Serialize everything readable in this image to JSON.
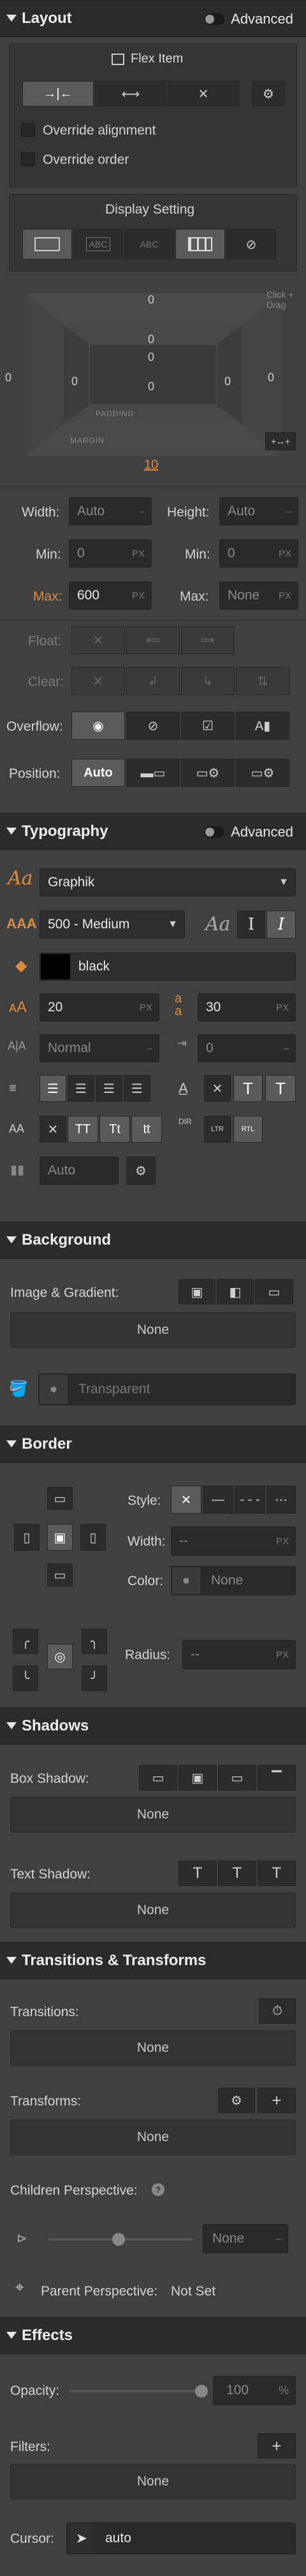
{
  "layout": {
    "title": "Layout",
    "advanced": "Advanced",
    "flex_item": "Flex Item",
    "override_alignment": "Override alignment",
    "override_order": "Override order",
    "display_setting": "Display Setting",
    "display_options": [
      "ABC",
      "ABC"
    ],
    "box": {
      "margin_top": "0",
      "margin_left": "0",
      "margin_right": "0",
      "padding_top": "0",
      "padding_left": "0",
      "padding_right": "0",
      "padding_bottom": "0",
      "padding_label": "PADDING",
      "margin_label": "MARGIN",
      "margin_bottom": "10",
      "hint": "Click + Drag"
    },
    "width_label": "Width:",
    "width_value": "Auto",
    "height_label": "Height:",
    "height_value": "Auto",
    "min_label": "Min:",
    "min_w": "0",
    "min_h": "0",
    "max_label": "Max:",
    "max_w": "600",
    "max_h": "None",
    "unit_px": "PX",
    "float_label": "Float:",
    "clear_label": "Clear:",
    "overflow_label": "Overflow:",
    "position_label": "Position:",
    "position_value": "Auto"
  },
  "typography": {
    "title": "Typography",
    "advanced": "Advanced",
    "font": "Graphik",
    "weight": "500 - Medium",
    "color_name": "black",
    "font_size": "20",
    "line_height": "30",
    "letter_spacing": "Normal",
    "text_indent": "0",
    "columns": "Auto",
    "case_tt1": "TT",
    "case_tt2": "Tt",
    "case_tt3": "tt",
    "dir_ltr": "LTR",
    "dir_rtl": "RTL",
    "dir_label": "DIR",
    "italic": "I",
    "aa_sample": "Aa",
    "swatch_color": "#000000"
  },
  "background": {
    "title": "Background",
    "image_gradient": "Image & Gradient:",
    "none": "None",
    "color": "Transparent"
  },
  "border": {
    "title": "Border",
    "style_label": "Style:",
    "width_label": "Width:",
    "width_value": "--",
    "color_label": "Color:",
    "color_value": "None",
    "radius_label": "Radius:",
    "radius_value": "--"
  },
  "shadows": {
    "title": "Shadows",
    "box_shadow": "Box Shadow:",
    "box_none": "None",
    "text_shadow": "Text Shadow:",
    "text_none": "None"
  },
  "transitions": {
    "title": "Transitions & Transforms",
    "transitions_label": "Transitions:",
    "transitions_none": "None",
    "transforms_label": "Transforms:",
    "transforms_none": "None",
    "children_perspective": "Children Perspective:",
    "perspective_value": "None",
    "parent_perspective": "Parent Perspective:",
    "parent_value": "Not Set"
  },
  "effects": {
    "title": "Effects",
    "opacity_label": "Opacity:",
    "opacity_value": "100",
    "opacity_unit": "%",
    "opacity_fraction": 1.0,
    "filters_label": "Filters:",
    "filters_none": "None",
    "cursor_label": "Cursor:",
    "cursor_value": "auto"
  }
}
